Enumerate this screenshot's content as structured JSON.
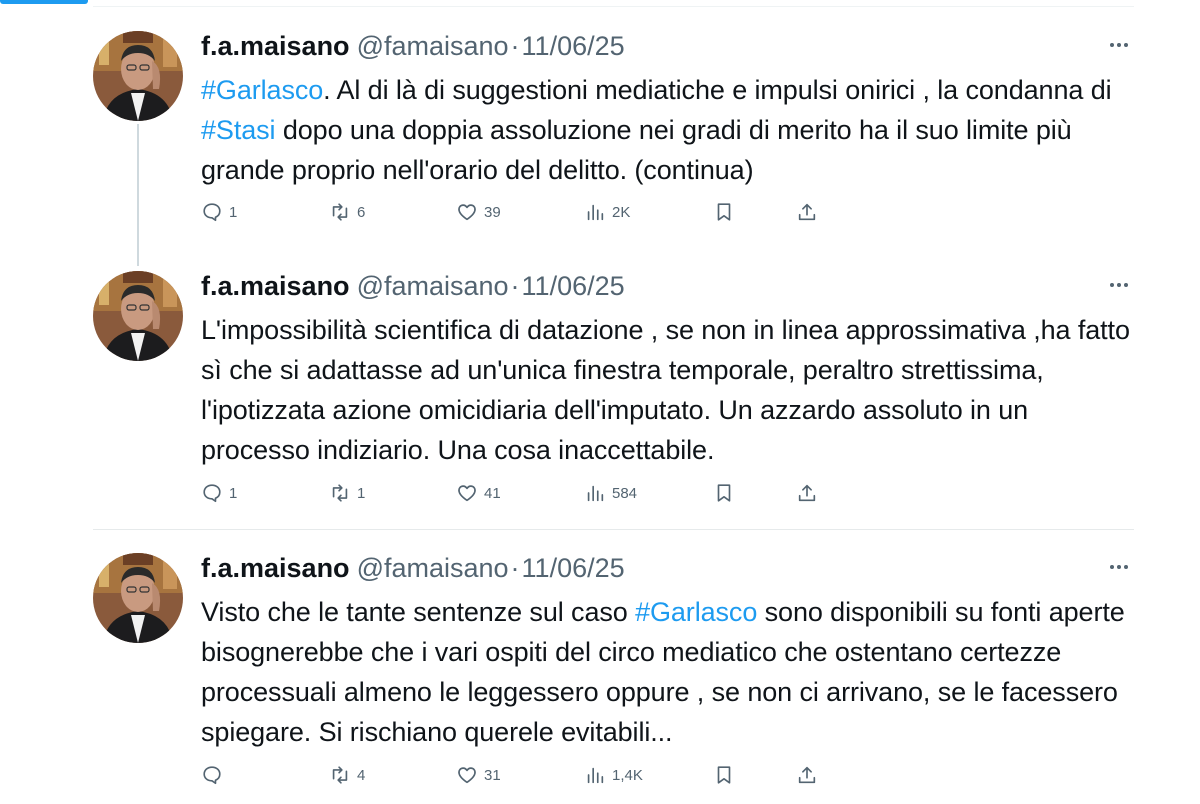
{
  "colors": {
    "accent": "#1d9bf0",
    "text_primary": "#0f1419",
    "text_secondary": "#536471",
    "thread_line": "#cfd9de",
    "divider": "#e6eaeb"
  },
  "icons": {
    "reply": "speech-bubble-icon",
    "retweet": "repost-arrows-icon",
    "like": "heart-icon",
    "views": "bar-chart-icon",
    "bookmark": "bookmark-icon",
    "share": "upload-share-icon",
    "more": "three-dots-icon"
  },
  "tweets": [
    {
      "author": {
        "display_name": "f.a.maisano",
        "handle": "@famaisano",
        "separator": "·",
        "date": "11/06/25"
      },
      "text": {
        "seg0": "#Garlasco",
        "seg1": ". Al di là di suggestioni mediatiche e impulsi onirici , la condanna di ",
        "seg2": "#Stasi",
        "seg3": " dopo una doppia assoluzione nei gradi di merito ha il suo limite più grande proprio nell'orario del delitto. (continua)"
      },
      "stats": {
        "replies": "1",
        "retweets": "6",
        "likes": "39",
        "views": "2K"
      }
    },
    {
      "author": {
        "display_name": "f.a.maisano",
        "handle": "@famaisano",
        "separator": "·",
        "date": "11/06/25"
      },
      "text": {
        "full": "L'impossibilità scientifica di datazione , se non in linea approssimativa ,ha fatto sì che si adattasse ad un'unica finestra temporale, peraltro strettissima, l'ipotizzata azione omicidiaria dell'imputato. Un azzardo assoluto in un processo indiziario. Una cosa inaccettabile."
      },
      "stats": {
        "replies": "1",
        "retweets": "1",
        "likes": "41",
        "views": "584"
      }
    },
    {
      "author": {
        "display_name": "f.a.maisano",
        "handle": "@famaisano",
        "separator": "·",
        "date": "11/06/25"
      },
      "text": {
        "seg0": "Visto che le tante sentenze sul caso ",
        "seg1": "#Garlasco",
        "seg2": " sono disponibili su fonti aperte bisognerebbe che i vari ospiti del circo mediatico che ostentano certezze processuali almeno le leggessero oppure , se non ci arrivano, se le facessero spiegare. Si rischiano querele evitabili..."
      },
      "stats": {
        "replies": "",
        "retweets": "4",
        "likes": "31",
        "views": "1,4K"
      }
    }
  ]
}
